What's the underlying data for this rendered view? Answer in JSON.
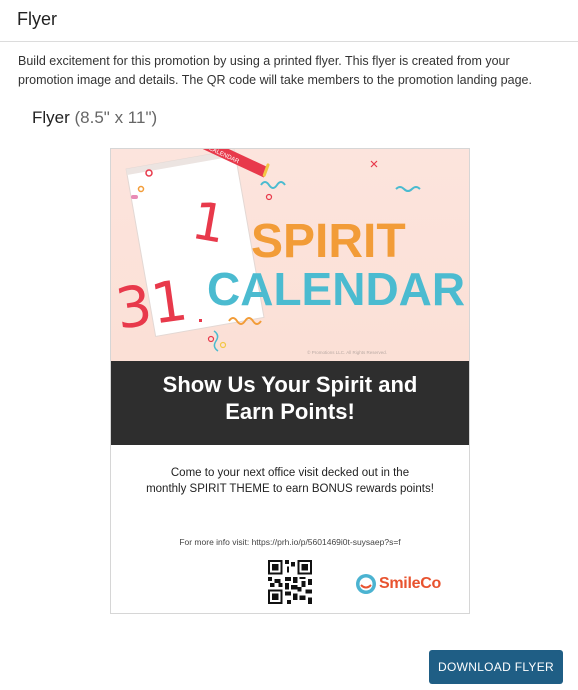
{
  "header": {
    "title": "Flyer"
  },
  "description": "Build excitement for this promotion by using a printed flyer. This flyer is created from your promotion image and details. The QR code will take members to the promotion landing page.",
  "flyer": {
    "label": "Flyer",
    "size": "(8.5\" x 11\")",
    "hero": {
      "title_line1": "SPIRIT",
      "title_line2": "CALENDAR",
      "calendar_numbers": "31",
      "calendar_number_top": "1",
      "ribbon_text": "CALENDAR",
      "copyright": "© Promotions LLC. All Rights Reserved."
    },
    "banner_line1": "Show Us Your Spirit and",
    "banner_line2": "Earn Points!",
    "promo_line1": "Come to your next office visit decked out in the",
    "promo_line2": "monthly SPIRIT THEME to earn BONUS rewards points!",
    "more_info": "For more info visit: https://prh.io/p/5601469i0t-suysaep?s=f",
    "logo_text": "SmileCo",
    "qr_icon": "qr-code-icon"
  },
  "actions": {
    "download_label": "DOWNLOAD FLYER"
  },
  "colors": {
    "button": "#1f5e85",
    "banner": "#2e2e2e",
    "logo": "#e8532f"
  }
}
